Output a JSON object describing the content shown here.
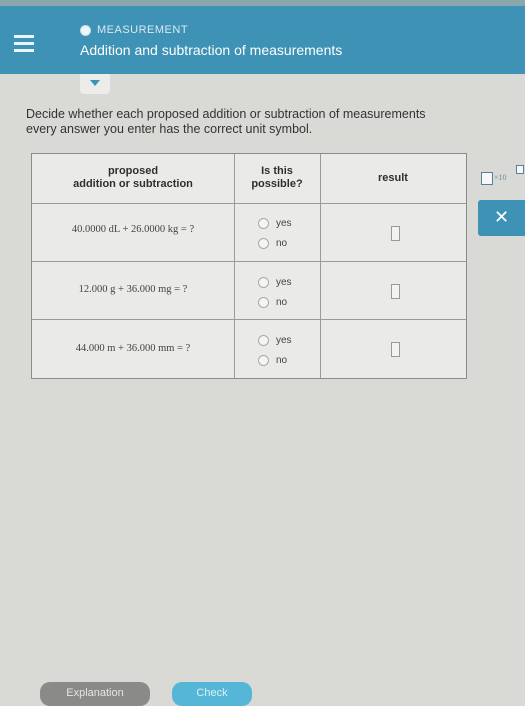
{
  "header": {
    "topic": "MEASUREMENT",
    "title": "Addition and subtraction of measurements"
  },
  "question": {
    "line1": "Decide whether each proposed addition or subtraction of measurements",
    "line2": "every answer you enter has the correct unit symbol."
  },
  "table": {
    "headers": {
      "col1_line1": "proposed",
      "col1_line2": "addition or subtraction",
      "col2_line1": "Is this",
      "col2_line2": "possible?",
      "col3": "result"
    },
    "rows": [
      {
        "expression": "40.0000 dL + 26.0000 kg = ?",
        "yes": "yes",
        "no": "no"
      },
      {
        "expression": "12.000 g + 36.000 mg = ?",
        "yes": "yes",
        "no": "no"
      },
      {
        "expression": "44.000 m + 36.000 mm = ?",
        "yes": "yes",
        "no": "no"
      }
    ]
  },
  "tools": {
    "sci_notation": "×10",
    "close_symbol": "✕"
  },
  "footer": {
    "explanation": "Explanation",
    "check": "Check"
  },
  "colors": {
    "header_blue": "#3e92b5",
    "check_blue": "#55b6d7"
  }
}
